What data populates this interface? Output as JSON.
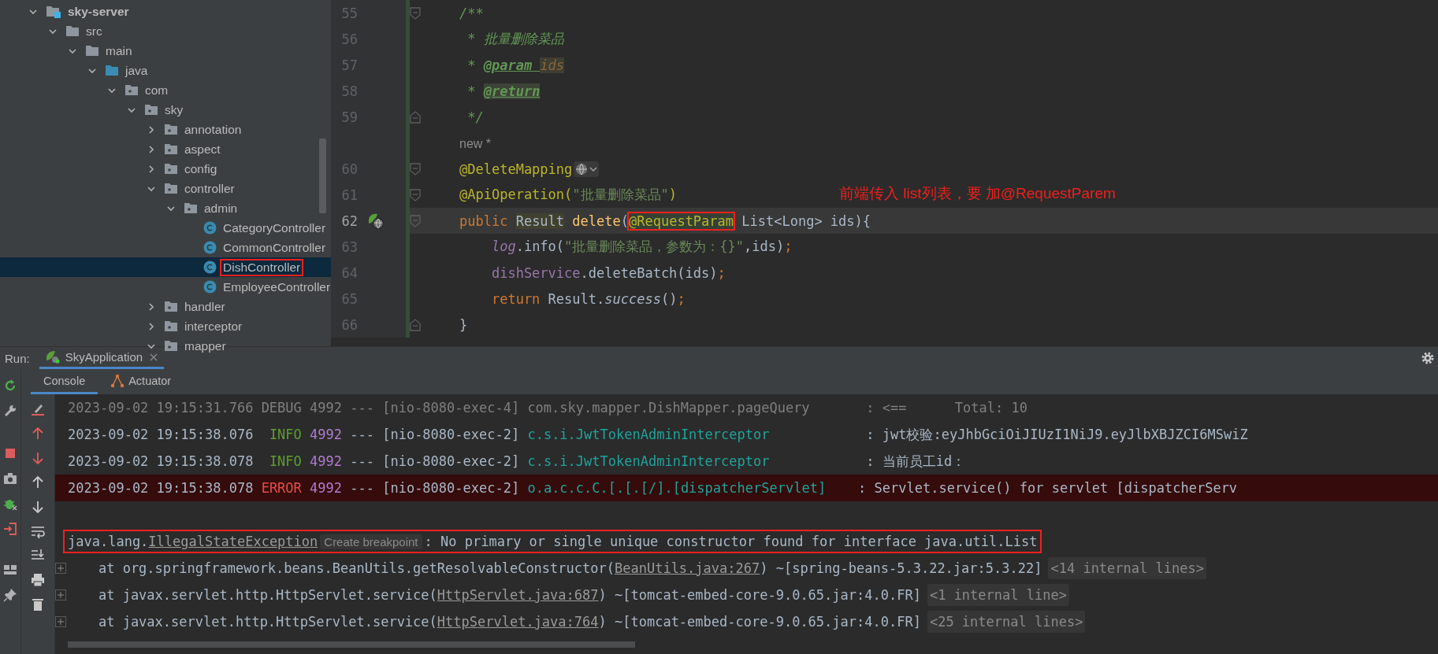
{
  "project_tree": [
    {
      "label": "sky-server",
      "kind": "module",
      "expanded": true,
      "selected": false,
      "children": [
        {
          "label": "src",
          "kind": "folder",
          "expanded": true,
          "selected": false,
          "children": [
            {
              "label": "main",
              "kind": "folder",
              "expanded": true,
              "selected": false,
              "children": [
                {
                  "label": "java",
                  "kind": "source",
                  "expanded": true,
                  "selected": false,
                  "children": [
                    {
                      "label": "com",
                      "kind": "package",
                      "expanded": true,
                      "selected": false,
                      "children": [
                        {
                          "label": "sky",
                          "kind": "package",
                          "expanded": true,
                          "selected": false,
                          "children": [
                            {
                              "label": "annotation",
                              "kind": "package",
                              "expanded": false,
                              "selected": false
                            },
                            {
                              "label": "aspect",
                              "kind": "package",
                              "expanded": false,
                              "selected": false
                            },
                            {
                              "label": "config",
                              "kind": "package",
                              "expanded": false,
                              "selected": false
                            },
                            {
                              "label": "controller",
                              "kind": "package",
                              "expanded": true,
                              "selected": false,
                              "children": [
                                {
                                  "label": "admin",
                                  "kind": "package",
                                  "expanded": true,
                                  "selected": false,
                                  "children": [
                                    {
                                      "label": "CategoryController",
                                      "kind": "class",
                                      "selected": false,
                                      "boxed": false
                                    },
                                    {
                                      "label": "CommonController",
                                      "kind": "class",
                                      "selected": false,
                                      "boxed": false
                                    },
                                    {
                                      "label": "DishController",
                                      "kind": "class",
                                      "selected": true,
                                      "boxed": true
                                    },
                                    {
                                      "label": "EmployeeController",
                                      "kind": "class",
                                      "selected": false,
                                      "boxed": false
                                    }
                                  ]
                                }
                              ]
                            },
                            {
                              "label": "handler",
                              "kind": "package",
                              "expanded": false,
                              "selected": false
                            },
                            {
                              "label": "interceptor",
                              "kind": "package",
                              "expanded": false,
                              "selected": false
                            },
                            {
                              "label": "mapper",
                              "kind": "package",
                              "expanded": true,
                              "selected": false
                            }
                          ]
                        }
                      ]
                    }
                  ]
                }
              ]
            }
          ]
        }
      ]
    }
  ],
  "editor": {
    "lines": [
      {
        "number": "55",
        "kind": "fold_start",
        "current": false,
        "tokens": [
          {
            "text": "/**",
            "kind": "doc"
          }
        ]
      },
      {
        "number": "56",
        "kind": "code",
        "current": false,
        "tokens": [
          {
            "text": " * 批量删除菜品",
            "kind": "doc"
          }
        ]
      },
      {
        "number": "57",
        "kind": "code",
        "current": false,
        "tokens": [
          {
            "text": " * ",
            "kind": "doc"
          },
          {
            "text": "@param ",
            "kind": "doctag"
          },
          {
            "text": "ids",
            "kind": "docparam"
          }
        ]
      },
      {
        "number": "58",
        "kind": "code",
        "current": false,
        "tokens": [
          {
            "text": " * ",
            "kind": "doc"
          },
          {
            "text": "@return",
            "kind": "doctag_hl"
          }
        ]
      },
      {
        "number": "59",
        "kind": "fold_end",
        "current": false,
        "tokens": [
          {
            "text": " */",
            "kind": "doc"
          }
        ]
      },
      {
        "kind": "code",
        "current": false,
        "tokens": [
          {
            "text": "new *",
            "kind": "hint"
          }
        ]
      },
      {
        "number": "60",
        "kind": "fold_start",
        "current": false,
        "endpoint_icon": true,
        "tokens": [
          {
            "text": "@DeleteMapping",
            "kind": "annotation"
          }
        ]
      },
      {
        "number": "61",
        "kind": "fold_start",
        "current": false,
        "tokens": [
          {
            "text": "@ApiOperation(",
            "kind": "annotation"
          },
          {
            "text": "\"批量删除菜品\"",
            "kind": "string"
          },
          {
            "text": ")",
            "kind": "annotation"
          }
        ]
      },
      {
        "number": "62",
        "kind": "fold_start",
        "current": true,
        "run_marker": true,
        "tokens": [
          {
            "text": "public ",
            "kind": "keyword"
          },
          {
            "text": "Result",
            "kind": "plain_hl"
          },
          {
            "text": " delete",
            "kind": "method"
          },
          {
            "text": "(",
            "kind": "plain"
          },
          {
            "text": "@RequestParam",
            "kind": "annotation_boxed"
          },
          {
            "text": " List<Long> ids){",
            "kind": "plain"
          }
        ]
      },
      {
        "number": "63",
        "kind": "code",
        "current": false,
        "tokens": [
          {
            "text": "    log",
            "kind": "static_field"
          },
          {
            "text": ".info(",
            "kind": "plain"
          },
          {
            "text": "\"批量删除菜品，参数为：{}\"",
            "kind": "string"
          },
          {
            "text": ",ids)",
            "kind": "plain"
          },
          {
            "text": ";",
            "kind": "keyword"
          }
        ]
      },
      {
        "number": "64",
        "kind": "code",
        "current": false,
        "tokens": [
          {
            "text": "    dishService",
            "kind": "field"
          },
          {
            "text": ".deleteBatch(ids)",
            "kind": "plain"
          },
          {
            "text": ";",
            "kind": "keyword"
          }
        ]
      },
      {
        "number": "65",
        "kind": "code",
        "current": false,
        "tokens": [
          {
            "text": "    return ",
            "kind": "keyword"
          },
          {
            "text": "Result.",
            "kind": "plain"
          },
          {
            "text": "success",
            "kind": "static_call"
          },
          {
            "text": "()",
            "kind": "plain"
          },
          {
            "text": ";",
            "kind": "keyword"
          }
        ]
      },
      {
        "number": "66",
        "kind": "fold_end",
        "current": false,
        "tokens": [
          {
            "text": "}",
            "kind": "plain"
          }
        ]
      }
    ],
    "annotation": {
      "text": "前端传入 list列表，要 加@RequestParem"
    }
  },
  "run_panel": {
    "label": "Run:",
    "tabs": [
      {
        "label": "SkyApplication",
        "selected": true
      }
    ],
    "console_tabs": [
      {
        "label": "Console",
        "selected": true
      },
      {
        "label": "Actuator",
        "selected": false
      }
    ],
    "lines": [
      {
        "kind": "log",
        "tokens": [
          {
            "text": "2023-09-02 19:15:31.766 DEBUG 4992 --- [nio-8080-exec-4] com.sky.mapper.DishMapper.pageQuery       : <==      Total: 10",
            "kind": "dim"
          }
        ]
      },
      {
        "kind": "log",
        "tokens": [
          {
            "text": "2023-09-02 19:15:38.076  ",
            "kind": "plain"
          },
          {
            "text": "INFO ",
            "kind": "info"
          },
          {
            "text": "4992",
            "kind": "pid"
          },
          {
            "text": " --- [nio-8080-exec-2] ",
            "kind": "plain"
          },
          {
            "text": "c.s.i.JwtTokenAdminInterceptor            ",
            "kind": "logger"
          },
          {
            "text": ": jwt校验:eyJhbGciOiJIUzI1NiJ9.eyJlbXBJZCI6MSwiZ",
            "kind": "plain"
          }
        ]
      },
      {
        "kind": "log",
        "tokens": [
          {
            "text": "2023-09-02 19:15:38.078  ",
            "kind": "plain"
          },
          {
            "text": "INFO ",
            "kind": "info"
          },
          {
            "text": "4992",
            "kind": "pid"
          },
          {
            "text": " --- [nio-8080-exec-2] ",
            "kind": "plain"
          },
          {
            "text": "c.s.i.JwtTokenAdminInterceptor            ",
            "kind": "logger"
          },
          {
            "text": ": 当前员工id：",
            "kind": "plain"
          }
        ]
      },
      {
        "kind": "error_log",
        "tokens": [
          {
            "text": "2023-09-02 19:15:38.078 ",
            "kind": "plain"
          },
          {
            "text": "ERROR ",
            "kind": "error"
          },
          {
            "text": "4992",
            "kind": "pid"
          },
          {
            "text": " --- [nio-8080-exec-2] ",
            "kind": "plain"
          },
          {
            "text": "o.a.c.c.C.[.[.[/].[dispatcherServlet]    ",
            "kind": "logger"
          },
          {
            "text": ": Servlet.service() for servlet [dispatcherServ",
            "kind": "plain"
          }
        ]
      },
      {
        "kind": "exception",
        "tokens": [
          {
            "text": "java.lang.",
            "kind": "plain"
          },
          {
            "text": "IllegalStateException",
            "kind": "link"
          },
          {
            "text": "Create breakpoint",
            "kind": "inlay"
          },
          {
            "text": ": No primary or single unique constructor found for interface java.util.List",
            "kind": "plain"
          }
        ]
      },
      {
        "kind": "stack",
        "tokens": [
          {
            "text": "    at org.springframework.beans.BeanUtils.getResolvableConstructor(",
            "kind": "plain"
          },
          {
            "text": "BeanUtils.java:267",
            "kind": "link"
          },
          {
            "text": ") ~[spring-beans-5.3.22.jar:5.3.22]",
            "kind": "plain"
          },
          {
            "text": "<14 internal lines>",
            "kind": "inlay"
          }
        ]
      },
      {
        "kind": "stack",
        "tokens": [
          {
            "text": "    at javax.servlet.http.HttpServlet.service(",
            "kind": "plain"
          },
          {
            "text": "HttpServlet.java:687",
            "kind": "link"
          },
          {
            "text": ") ~[tomcat-embed-core-9.0.65.jar:4.0.FR]",
            "kind": "plain"
          },
          {
            "text": "<1 internal line>",
            "kind": "inlay"
          }
        ]
      },
      {
        "kind": "stack",
        "tokens": [
          {
            "text": "    at javax.servlet.http.HttpServlet.service(",
            "kind": "plain"
          },
          {
            "text": "HttpServlet.java:764",
            "kind": "link"
          },
          {
            "text": ") ~[tomcat-embed-core-9.0.65.jar:4.0.FR]",
            "kind": "plain"
          },
          {
            "text": "<25 internal lines>",
            "kind": "inlay"
          }
        ]
      }
    ]
  }
}
